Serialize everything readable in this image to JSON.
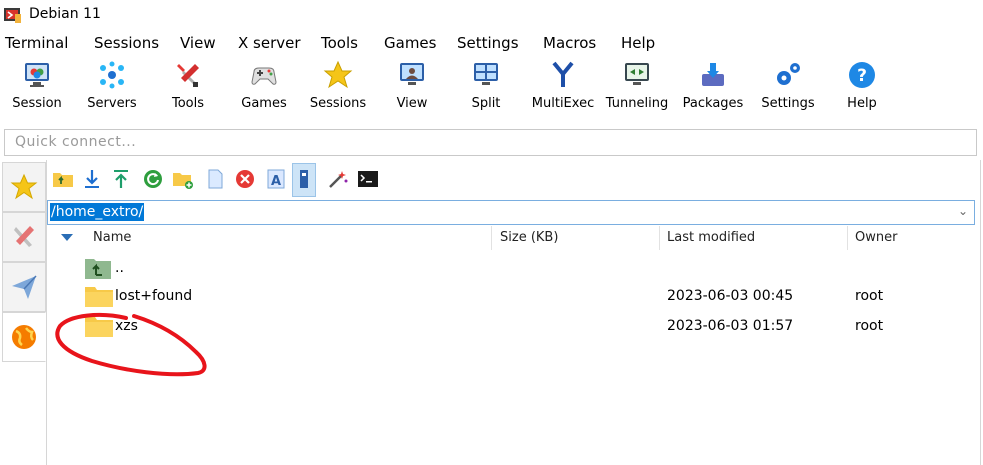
{
  "window": {
    "title": "Debian 11"
  },
  "menu": [
    "Terminal",
    "Sessions",
    "View",
    "X server",
    "Tools",
    "Games",
    "Settings",
    "Macros",
    "Help"
  ],
  "toolbar": [
    {
      "label": "Session",
      "icon": "monitor-session-icon"
    },
    {
      "label": "Servers",
      "icon": "servers-icon"
    },
    {
      "label": "Tools",
      "icon": "tools-icon"
    },
    {
      "label": "Games",
      "icon": "gamepad-icon"
    },
    {
      "label": "Sessions",
      "icon": "star-icon"
    },
    {
      "label": "View",
      "icon": "view-icon"
    },
    {
      "label": "Split",
      "icon": "split-icon"
    },
    {
      "label": "MultiExec",
      "icon": "multiexec-icon"
    },
    {
      "label": "Tunneling",
      "icon": "tunneling-icon"
    },
    {
      "label": "Packages",
      "icon": "packages-icon"
    },
    {
      "label": "Settings",
      "icon": "settings-gears-icon"
    },
    {
      "label": "Help",
      "icon": "help-icon"
    }
  ],
  "quick_connect": {
    "placeholder": "Quick connect..."
  },
  "sftp": {
    "path": "/home_extro/",
    "columns": {
      "name": "Name",
      "size": "Size (KB)",
      "modified": "Last modified",
      "owner": "Owner"
    },
    "rows": [
      {
        "name": "..",
        "size": "",
        "modified": "",
        "owner": "",
        "type": "parent"
      },
      {
        "name": "lost+found",
        "size": "",
        "modified": "2023-06-03 00:45",
        "owner": "root",
        "type": "folder"
      },
      {
        "name": "xzs",
        "size": "",
        "modified": "2023-06-03 01:57",
        "owner": "root",
        "type": "folder"
      }
    ]
  },
  "colors": {
    "folder": "#f7c948",
    "selection": "#0078d7",
    "annotation": "#e8141b"
  }
}
